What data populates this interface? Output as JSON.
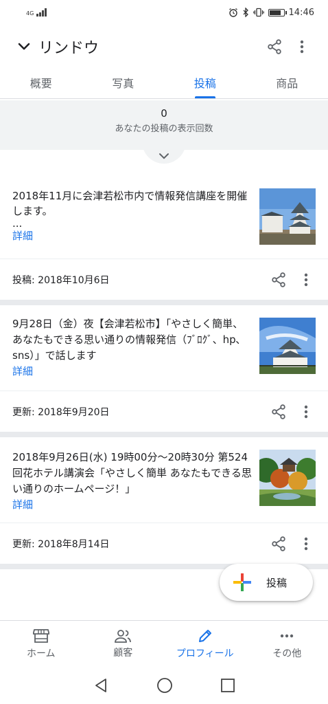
{
  "status": {
    "network": "4G",
    "time": "14:46",
    "battery_level": 0.8
  },
  "app_bar": {
    "title": "リンドウ"
  },
  "tabs": [
    {
      "label": "概要",
      "active": false
    },
    {
      "label": "写真",
      "active": false
    },
    {
      "label": "投稿",
      "active": true
    },
    {
      "label": "商品",
      "active": false
    }
  ],
  "stats": {
    "count": "0",
    "label": "あなたの投稿の表示回数"
  },
  "posts": [
    {
      "text": "2018年11月に会津若松市内で情報発信講座を開催します。",
      "ellipsis": "...",
      "detail_label": "詳細",
      "date_label": "投稿: 2018年10月6日"
    },
    {
      "text": "9月28日（金）夜【会津若松市】「やさしく簡単、あなたもできる思い通りの情報発信（ﾌﾞﾛｸﾞ、hp､sns）」で話します",
      "detail_label": "詳細",
      "date_label": "更新: 2018年9月20日"
    },
    {
      "text": "2018年9月26日(水) 19時00分～20時30分 第524回花ホテル講演会「やさしく簡単 あなたもできる思い通りのホームページ！」",
      "detail_label": "詳細",
      "date_label": "更新: 2018年8月14日"
    }
  ],
  "fab": {
    "label": "投稿"
  },
  "bottom_nav": [
    {
      "label": "ホーム",
      "icon": "store-icon",
      "active": false
    },
    {
      "label": "顧客",
      "icon": "people-icon",
      "active": false
    },
    {
      "label": "プロフィール",
      "icon": "edit-icon",
      "active": true
    },
    {
      "label": "その他",
      "icon": "more-horizontal-icon",
      "active": false
    }
  ],
  "colors": {
    "accent": "#1a73e8",
    "text": "#202124",
    "muted": "#5f6368",
    "stats_bg": "#f1f3f4"
  }
}
